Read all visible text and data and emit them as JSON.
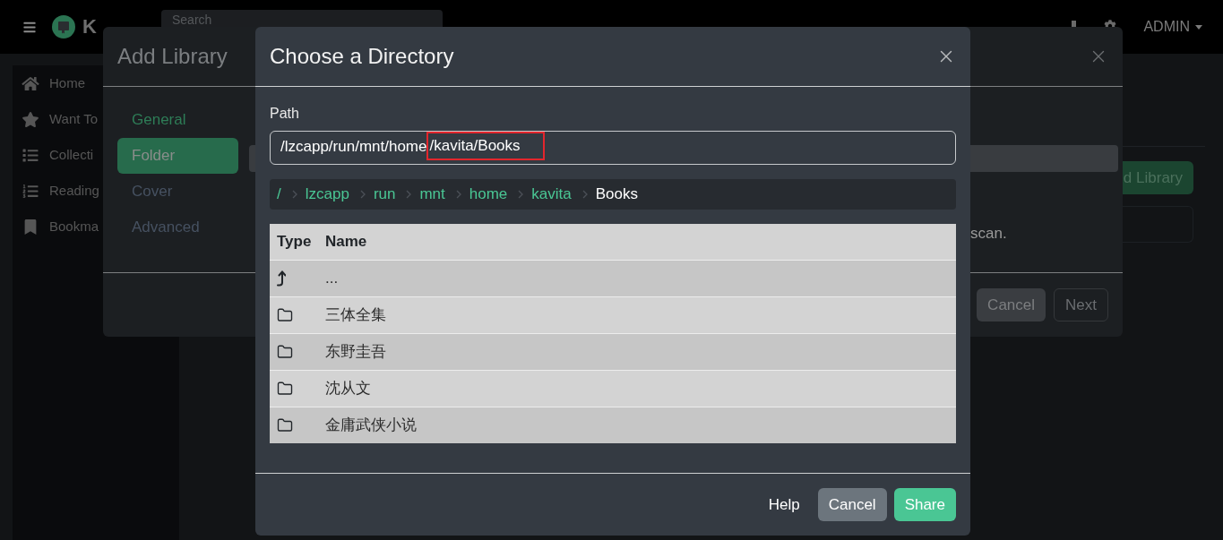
{
  "navbar": {
    "brand": "K",
    "search": {
      "placeholder": "Search"
    },
    "user_menu": "ADMIN"
  },
  "sidebar": {
    "items": [
      {
        "label": "Home"
      },
      {
        "label": "Want To"
      },
      {
        "label": "Collecti"
      },
      {
        "label": "Reading"
      },
      {
        "label": "Bookma"
      }
    ]
  },
  "page": {
    "button": "d Library"
  },
  "add_library": {
    "title": "Add Library",
    "steps": [
      {
        "label": "General",
        "selected": false,
        "disabled": false
      },
      {
        "label": "Folder",
        "selected": true,
        "disabled": false
      },
      {
        "label": "Cover",
        "selected": false,
        "disabled": true
      },
      {
        "label": "Advanced",
        "selected": false,
        "disabled": true
      }
    ],
    "body_text": "scan.",
    "buttons": [
      {
        "label": "Cancel",
        "kind": "secondary"
      },
      {
        "label": "Next",
        "kind": "outline"
      }
    ]
  },
  "directory_dialog": {
    "title": "Choose a Directory",
    "path": {
      "label": "Path",
      "value_parts": [
        {
          "text": "/lzcapp/run/mnt/home",
          "highlighted": false
        },
        {
          "text": "/kavita/Books",
          "highlighted": true
        }
      ]
    },
    "breadcrumb": [
      {
        "label": "/",
        "selected": false
      },
      {
        "label": "lzcapp",
        "selected": false
      },
      {
        "label": "run",
        "selected": false
      },
      {
        "label": "mnt",
        "selected": false
      },
      {
        "label": "home",
        "selected": false
      },
      {
        "label": "kavita",
        "selected": false
      },
      {
        "label": "Books",
        "selected": true
      }
    ],
    "table": {
      "columns": [
        "Type",
        "Name"
      ],
      "rows": [
        {
          "kind": "parent",
          "name": "..."
        },
        {
          "kind": "folder",
          "name": "三体全集"
        },
        {
          "kind": "folder",
          "name": "东野圭吾"
        },
        {
          "kind": "folder",
          "name": "沈从文"
        },
        {
          "kind": "folder",
          "name": "金庸武侠小说"
        }
      ]
    },
    "buttons": [
      {
        "label": "Help",
        "kind": "link"
      },
      {
        "label": "Cancel",
        "kind": "secondary"
      },
      {
        "label": "Share",
        "kind": "primary"
      }
    ]
  }
}
